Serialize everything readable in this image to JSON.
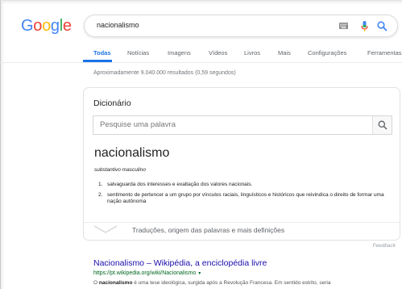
{
  "header": {
    "logo_text": "Google",
    "logo_letters": [
      {
        "ch": "G",
        "color": "#4285F4"
      },
      {
        "ch": "o",
        "color": "#EA4335"
      },
      {
        "ch": "o",
        "color": "#FBBC05"
      },
      {
        "ch": "g",
        "color": "#4285F4"
      },
      {
        "ch": "l",
        "color": "#34A853"
      },
      {
        "ch": "e",
        "color": "#EA4335"
      }
    ],
    "search_query": "nacionalismo",
    "icons": [
      "keyboard-icon",
      "microphone-icon",
      "search-icon"
    ]
  },
  "tabs": [
    {
      "label": "Todas",
      "active": true
    },
    {
      "label": "Notícias",
      "active": false
    },
    {
      "label": "Imagens",
      "active": false
    },
    {
      "label": "Vídeos",
      "active": false
    },
    {
      "label": "Livros",
      "active": false
    },
    {
      "label": "Mais",
      "active": false
    },
    {
      "label": "Configurações",
      "active": false
    },
    {
      "label": "Ferramentas",
      "active": false
    }
  ],
  "stats": "Aproximadamente 9.040.000 resultados (0,59 segundos)",
  "dictionary": {
    "title": "Dicionário",
    "search_placeholder": "Pesquise uma palavra",
    "word": "nacionalismo",
    "part_of_speech": "substantivo masculino",
    "definitions": [
      {
        "num": "1.",
        "text": "salvaguarda dos interesses e exaltação dos valores nacionais."
      },
      {
        "num": "2.",
        "text": "sentimento de pertencer a um grupo por vínculos raciais, linguísticos e históricos que reivindica o direito de formar uma nação autônoma"
      }
    ],
    "more_label": "Traduções, origem das palavras e mais definições",
    "feedback": "Feedback"
  },
  "result": {
    "title": "Nacionalismo – Wikipédia, a enciclopédia livre",
    "url": "https://pt.wikipedia.org/wiki/Nacionalismo",
    "url_caret": "▾",
    "snippet_bold": "nacionalismo",
    "snippet_before": "O ",
    "snippet_after": " é uma tese ideológica, surgida após a Revolução Francesa. Em sentido estrito, seria"
  },
  "colors": {
    "link": "#1a0dab",
    "url": "#006621",
    "accent": "#1a73e8"
  }
}
